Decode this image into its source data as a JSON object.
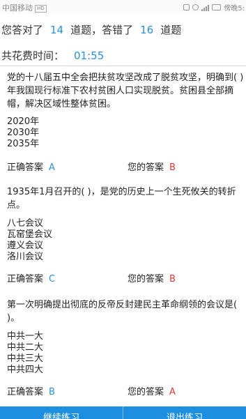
{
  "status_bar": {
    "carrier": "中国移动",
    "network_badge": "HD",
    "clock": "傍晚5:"
  },
  "summary": {
    "prefix": "您答对了",
    "correct": "14",
    "middle": "道题，答错了",
    "wrong": "16",
    "suffix": "道题"
  },
  "timer": {
    "label": "共花费时间：",
    "value": "01:55"
  },
  "answer_labels": {
    "correct": "正确答案",
    "yours": "您的答案"
  },
  "questions": [
    {
      "text": "党的十八届五中全会把扶贫攻坚改成了脱贫攻坚，明确到( )年我国现行标准下农村贫困人口实现脱贫。贫困县全部摘帽，解决区域性整体贫困。",
      "options": [
        "2020年",
        "2030年",
        "2035年"
      ],
      "correct_answer": "A",
      "your_answer": "B"
    },
    {
      "text": "1935年1月召开的( )，是党的历史上一个生死攸关的转折点。",
      "options": [
        "八七会议",
        "瓦窑堡会议",
        "遵义会议",
        "洛川会议"
      ],
      "correct_answer": "C",
      "your_answer": "B"
    },
    {
      "text": "第一次明确提出彻底的反帝反封建民主革命纲领的会议是( )。",
      "options": [
        "中共一大",
        "中共二大",
        "中共三大",
        "中共四大"
      ],
      "correct_answer": "B",
      "your_answer": "A"
    }
  ],
  "buttons": {
    "left": "继续练习",
    "right": "退出练习"
  },
  "colors": {
    "accent_blue": "#2a8fd6",
    "wrong_red": "#d83a3a",
    "bottom_bar": "#1e8fe0"
  }
}
